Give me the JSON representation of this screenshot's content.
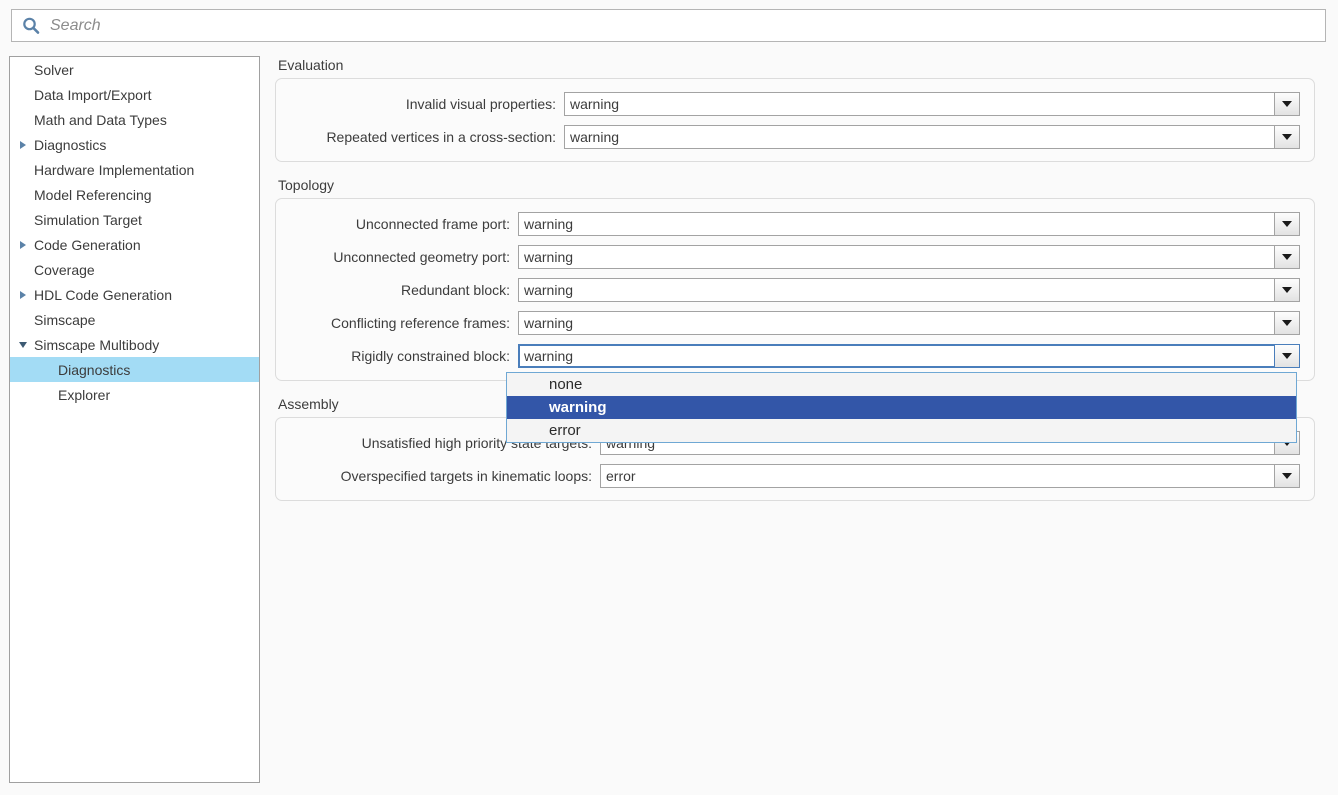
{
  "search": {
    "placeholder": "Search",
    "value": "",
    "icon": "search-icon"
  },
  "sidebar": {
    "items": [
      {
        "label": "Solver",
        "level": 0,
        "twisty": "none",
        "selected": false
      },
      {
        "label": "Data Import/Export",
        "level": 0,
        "twisty": "none",
        "selected": false
      },
      {
        "label": "Math and Data Types",
        "level": 0,
        "twisty": "none",
        "selected": false
      },
      {
        "label": "Diagnostics",
        "level": 0,
        "twisty": "collapsed",
        "selected": false
      },
      {
        "label": "Hardware Implementation",
        "level": 0,
        "twisty": "none",
        "selected": false
      },
      {
        "label": "Model Referencing",
        "level": 0,
        "twisty": "none",
        "selected": false
      },
      {
        "label": "Simulation Target",
        "level": 0,
        "twisty": "none",
        "selected": false
      },
      {
        "label": "Code Generation",
        "level": 0,
        "twisty": "collapsed",
        "selected": false
      },
      {
        "label": "Coverage",
        "level": 0,
        "twisty": "none",
        "selected": false
      },
      {
        "label": "HDL Code Generation",
        "level": 0,
        "twisty": "collapsed",
        "selected": false
      },
      {
        "label": "Simscape",
        "level": 0,
        "twisty": "none",
        "selected": false
      },
      {
        "label": "Simscape Multibody",
        "level": 0,
        "twisty": "expanded",
        "selected": false
      },
      {
        "label": "Diagnostics",
        "level": 1,
        "twisty": "none",
        "selected": true
      },
      {
        "label": "Explorer",
        "level": 1,
        "twisty": "none",
        "selected": false
      }
    ]
  },
  "sections": [
    {
      "title": "Evaluation",
      "fields": [
        {
          "label": "Invalid visual properties:",
          "value": "warning"
        },
        {
          "label": "Repeated vertices in a cross-section:",
          "value": "warning"
        }
      ]
    },
    {
      "title": "Topology",
      "fields": [
        {
          "label": "Unconnected frame port:",
          "value": "warning"
        },
        {
          "label": "Unconnected geometry port:",
          "value": "warning"
        },
        {
          "label": "Redundant block:",
          "value": "warning"
        },
        {
          "label": "Conflicting reference frames:",
          "value": "warning"
        },
        {
          "label": "Rigidly constrained block:",
          "value": "warning"
        }
      ]
    },
    {
      "title": "Assembly",
      "fields": [
        {
          "label": "Unsatisfied high priority state targets:",
          "value": "warning"
        },
        {
          "label": "Overspecified targets in kinematic loops:",
          "value": "error"
        }
      ]
    }
  ],
  "dropdown": {
    "open_for_field": "Rigidly constrained block:",
    "options": [
      "none",
      "warning",
      "error"
    ],
    "selected": "warning"
  },
  "colors": {
    "tree_selection": "#a3dcf5",
    "dropdown_selection": "#3356a8",
    "focus_border": "#4a7ebb",
    "page_background": "#fafafa",
    "panel_background": "#ffffff"
  }
}
